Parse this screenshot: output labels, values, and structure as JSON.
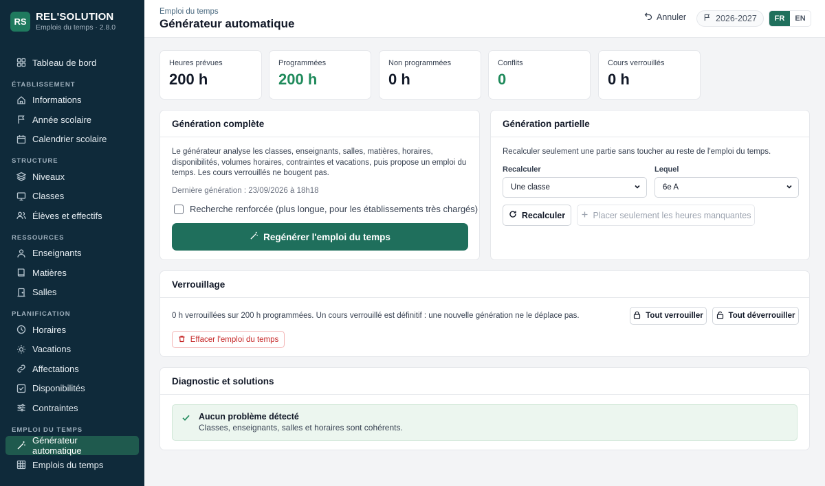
{
  "brand": {
    "logo": "RS",
    "name": "REL'SOLUTION",
    "subtitle": "Emplois du temps · 2.8.0"
  },
  "sidebar": {
    "dashboard": "Tableau de bord",
    "sections": {
      "etablissement": "ÉTABLISSEMENT",
      "structure": "STRUCTURE",
      "ressources": "RESSOURCES",
      "planification": "PLANIFICATION",
      "emploi": "EMPLOI DU TEMPS"
    },
    "items": {
      "informations": "Informations",
      "annee": "Année scolaire",
      "calendrier": "Calendrier scolaire",
      "niveaux": "Niveaux",
      "classes": "Classes",
      "eleves": "Élèves et effectifs",
      "enseignants": "Enseignants",
      "matieres": "Matières",
      "salles": "Salles",
      "horaires": "Horaires",
      "vacations": "Vacations",
      "affectations": "Affectations",
      "disponibilites": "Disponibilités",
      "contraintes": "Contraintes",
      "generateur": "Générateur automatique",
      "emplois": "Emplois du temps"
    }
  },
  "header": {
    "breadcrumb": "Emploi du temps",
    "title": "Générateur automatique",
    "undo": "Annuler",
    "year": "2026-2027",
    "lang_fr": "FR",
    "lang_en": "EN"
  },
  "stats": [
    {
      "label": "Heures prévues",
      "value": "200 h"
    },
    {
      "label": "Programmées",
      "value": "200 h"
    },
    {
      "label": "Non programmées",
      "value": "0 h"
    },
    {
      "label": "Conflits",
      "value": "0"
    },
    {
      "label": "Cours verrouillés",
      "value": "0 h"
    }
  ],
  "full_gen": {
    "title": "Génération complète",
    "description": "Le générateur analyse les classes, enseignants, salles, matières, horaires, disponibilités, volumes horaires, contraintes et vacations, puis propose un emploi du temps. Les cours verrouillés ne bougent pas.",
    "last_run": "Dernière génération : 23/09/2026 à 18h18",
    "checkbox": "Recherche renforcée (plus longue, pour les établissements très chargés)",
    "button": "Regénérer l'emploi du temps"
  },
  "partial_gen": {
    "title": "Génération partielle",
    "description": "Recalculer seulement une partie sans toucher au reste de l'emploi du temps.",
    "recalc_label": "Recalculer",
    "recalc_value": "Une classe",
    "which_label": "Lequel",
    "which_value": "6e A",
    "recalc_button": "Recalculer",
    "place_button": "Placer seulement les heures manquantes"
  },
  "locking": {
    "title": "Verrouillage",
    "description": "0 h verrouillées sur 200 h programmées. Un cours verrouillé est définitif : une nouvelle génération ne le déplace pas.",
    "lock_all": "Tout verrouiller",
    "unlock_all": "Tout déverrouiller",
    "clear": "Effacer l'emploi du temps"
  },
  "diagnostic": {
    "title": "Diagnostic et solutions",
    "ok_title": "Aucun problème détecté",
    "ok_sub": "Classes, enseignants, salles et horaires sont cohérents."
  },
  "colors": {
    "sidebar": "#0f2a3a",
    "accent": "#1f6f5c",
    "success": "#1f8a5b",
    "danger": "#c62828"
  }
}
